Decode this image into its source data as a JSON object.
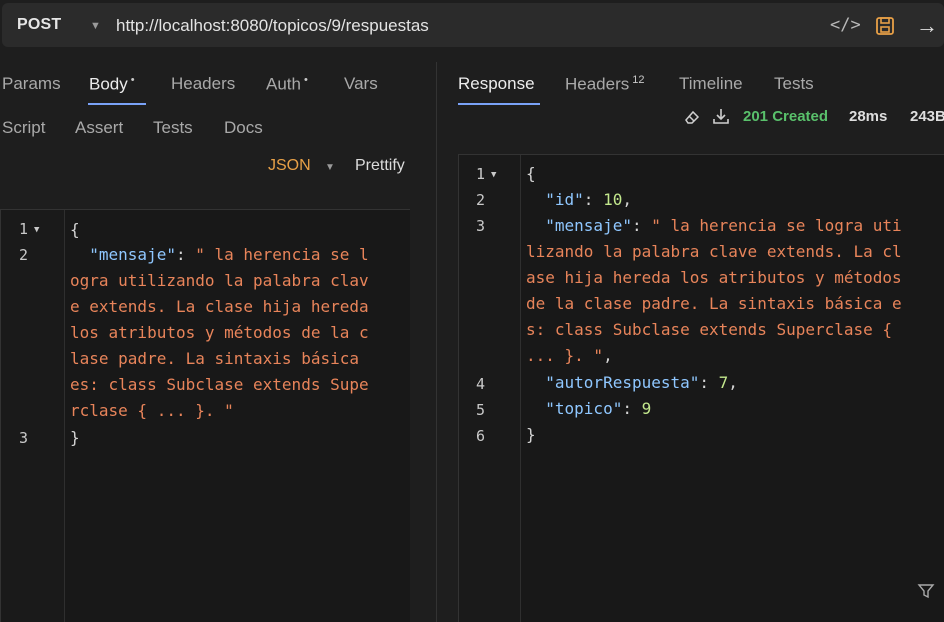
{
  "request": {
    "method": "POST",
    "url": "http://localhost:8080/topicos/9/respuestas"
  },
  "request_tabs": {
    "params": "Params",
    "body": "Body",
    "headers": "Headers",
    "auth": "Auth",
    "vars": "Vars",
    "script": "Script",
    "assert": "Assert",
    "tests": "Tests",
    "docs": "Docs",
    "body_marker": "•",
    "auth_marker": "•"
  },
  "body_mode": "JSON",
  "prettify": "Prettify",
  "response_tabs": {
    "response": "Response",
    "headers": "Headers",
    "headers_count": "12",
    "timeline": "Timeline",
    "tests": "Tests"
  },
  "status": {
    "code": "201 Created",
    "time": "28ms",
    "size": "243B"
  },
  "request_body": {
    "line_numbers": [
      "1",
      "2",
      "3"
    ],
    "brace_open": "{",
    "key": "\"mensaje\"",
    "colon": ": ",
    "value_lines": [
      "\" la herencia se l",
      "ogra utilizando la palabra clav",
      "e extends. La clase hija hereda",
      "los atributos y métodos de la c",
      "lase padre. La sintaxis básica",
      "es: class Subclase extends Supe",
      "rclase { ... }. \""
    ],
    "brace_close": "}"
  },
  "response_body": {
    "line_numbers": [
      "1",
      "2",
      "3",
      "4",
      "5",
      "6"
    ],
    "brace_open": "{",
    "id_key": "\"id\"",
    "id_value": "10",
    "mensaje_key": "\"mensaje\"",
    "mensaje_lines": [
      "\" la herencia se logra uti",
      "lizando la palabra clave extends. La cl",
      "ase hija hereda los atributos y métodos",
      "de la clase padre. La sintaxis básica e",
      "s: class Subclase extends Superclase {",
      "... }. \""
    ],
    "autor_key": "\"autorRespuesta\"",
    "autor_value": "7",
    "topico_key": "\"topico\"",
    "topico_value": "9",
    "brace_close": "}"
  },
  "colors": {
    "accent": "#7aa2f7",
    "json_key": "#8fc7ff",
    "json_string": "#e8845a",
    "json_number": "#c3e88d",
    "status_ok": "#59c06b",
    "body_mode": "#e8a047"
  },
  "icons": [
    "chevron-down-icon",
    "code-icon",
    "save-icon",
    "send-arrow-icon",
    "eraser-icon",
    "download-icon",
    "fold-caret-icon",
    "filter-icon"
  ]
}
